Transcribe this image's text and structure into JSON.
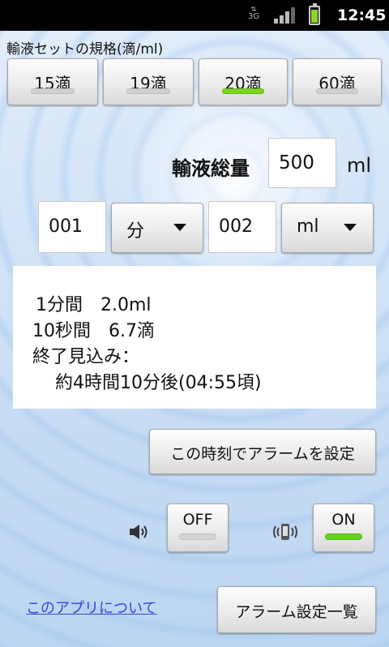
{
  "statusbar": {
    "network": "3G",
    "time": "12:45"
  },
  "spec": {
    "label": "輸液セットの規格(滴/ml)",
    "options": [
      {
        "label": "15滴",
        "selected": false
      },
      {
        "label": "19滴",
        "selected": false
      },
      {
        "label": "20滴",
        "selected": true
      },
      {
        "label": "60滴",
        "selected": false
      }
    ]
  },
  "total": {
    "label": "輸液総量",
    "value": "500",
    "unit": "ml"
  },
  "rate": {
    "time_value": "001",
    "time_unit": "分",
    "volume_value": "002",
    "volume_unit": "ml"
  },
  "result": {
    "line1": "1分間　2.0ml",
    "line2": "10秒間　6.7滴",
    "line3": "終了見込み：",
    "line4": "約4時間10分後(04:55頃)"
  },
  "alarm_button": "この時刻でアラームを設定",
  "sound": {
    "icon": "speaker-icon",
    "state": "OFF"
  },
  "vibrate": {
    "icon": "vibrate-icon",
    "state": "ON"
  },
  "about_link": "このアプリについて",
  "alarm_list_button": "アラーム設定一覧",
  "colors": {
    "on": "#7ed41c",
    "link": "#3a44d6"
  }
}
